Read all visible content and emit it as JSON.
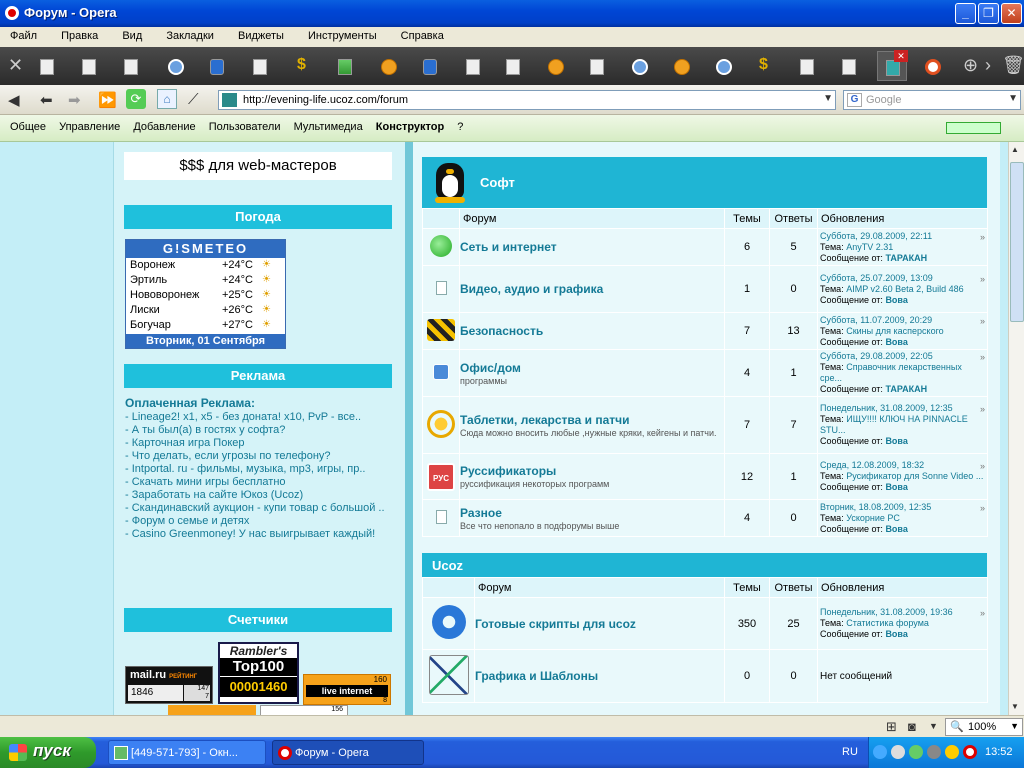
{
  "window": {
    "title": "Форум - Opera"
  },
  "menu": [
    "Файл",
    "Правка",
    "Вид",
    "Закладки",
    "Виджеты",
    "Инструменты",
    "Справка"
  ],
  "address": {
    "url": "http://evening-life.ucoz.com/forum",
    "search_placeholder": "Google",
    "search_engine_icon": "G"
  },
  "ucoz_panel": {
    "items": [
      "Общее",
      "Управление",
      "Добавление",
      "Пользователи",
      "Мультимедиа"
    ],
    "bold_item": "Конструктор",
    "help": "?"
  },
  "left": {
    "webmasters": "$$$ для web-мастеров",
    "weather_title": "Погода",
    "gismeteo": {
      "title": "G!SMETEO",
      "rows": [
        {
          "city": "Воронеж",
          "temp": "+24°C"
        },
        {
          "city": "Эртиль",
          "temp": "+24°C"
        },
        {
          "city": "Нововоронеж",
          "temp": "+25°C"
        },
        {
          "city": "Лиски",
          "temp": "+26°C"
        },
        {
          "city": "Богучар",
          "temp": "+27°C"
        }
      ],
      "date": "Вторник, 01 Сентября"
    },
    "ads_title": "Реклама",
    "ads_paid": "Оплаченная Реклама:",
    "ads": [
      "- Lineage2! x1, x5 - без доната! x10, PvP - все..",
      "- А ты был(а) в гостях у софта?",
      "- Карточная игра Покер",
      "- Что делать, если угрозы по телефону?",
      "- Intportal. ru - фильмы, музыка, mp3, игры, пр..",
      "- Скачать мини игры бесплатно",
      "- Заработать на сайте Юкоз (Ucoz)",
      "- Скандинавский аукцион - купи товар с большой ..",
      "- Форум о семье и детях",
      "- Casino Greenmoney! У нас выигрывает каждый!"
    ],
    "counters_title": "Счетчики",
    "counters": {
      "mail_logo": "mail.ru",
      "mail_tag": "РЕЙТИНГ",
      "mail_value": "1846",
      "mail_small1": "147",
      "mail_small2": "7",
      "rambler_name": "Rambler's",
      "rambler_top": "Top100",
      "rambler_value": "00001460",
      "li_value1": "160",
      "li_logo": "live internet",
      "li_value2": "8",
      "extra_value": "156"
    }
  },
  "forum": {
    "categories": [
      {
        "title": "Софт",
        "headers": {
          "forum": "Форум",
          "topics": "Темы",
          "replies": "Ответы",
          "updates": "Обновления"
        },
        "rows": [
          {
            "icon": "network-icon",
            "name": "Сеть и интернет",
            "desc": "",
            "topics": "6",
            "replies": "5",
            "date": "Суббота, 29.08.2009, 22:11",
            "topic_label": "Тема:",
            "topic": "AnyTV 2.31",
            "msg_label": "Сообщение от:",
            "author": "ТАРАКАН"
          },
          {
            "icon": "document-icon",
            "name": "Видео, аудио и графика",
            "desc": "",
            "topics": "1",
            "replies": "0",
            "date": "Суббота, 25.07.2009, 13:09",
            "topic_label": "Тема:",
            "topic": "AIMP v2.60 Beta 2, Build 486",
            "msg_label": "Сообщение от:",
            "author": "Вова"
          },
          {
            "icon": "security-icon",
            "name": "Безопасность",
            "desc": "",
            "topics": "7",
            "replies": "13",
            "date": "Суббота, 11.07.2009, 20:29",
            "topic_label": "Тема:",
            "topic": "Скины для касперского",
            "msg_label": "Сообщение от:",
            "author": "Вова"
          },
          {
            "icon": "office-icon",
            "name": "Офис/дом",
            "desc": "программы",
            "topics": "4",
            "replies": "1",
            "date": "Суббота, 29.08.2009, 22:05",
            "topic_label": "Тема:",
            "topic": "Справочник лекарственных сре...",
            "msg_label": "Сообщение от:",
            "author": "ТАРАКАН"
          },
          {
            "icon": "keys-icon",
            "name": "Таблетки, лекарства и патчи",
            "desc": "Сюда можно вносить любые ,нужные кряки, кейгены и патчи.",
            "topics": "7",
            "replies": "7",
            "date": "Понедельник, 31.08.2009, 12:35",
            "topic_label": "Тема:",
            "topic": "ИЩУ!!!! КЛЮЧ НА PINNACLE STU...",
            "msg_label": "Сообщение от:",
            "author": "Вова"
          },
          {
            "icon": "russifier-icon",
            "name": "Руссификаторы",
            "desc": "руссификация некоторых программ",
            "topics": "12",
            "replies": "1",
            "date": "Среда, 12.08.2009, 18:32",
            "topic_label": "Тема:",
            "topic": "Русификатор для Sonne Video ...",
            "msg_label": "Сообщение от:",
            "author": "Вова"
          },
          {
            "icon": "document-icon",
            "name": "Разное",
            "desc": "Все что непопало в подфорумы выше",
            "topics": "4",
            "replies": "0",
            "date": "Вторник, 18.08.2009, 12:35",
            "topic_label": "Тема:",
            "topic": "Ускорние PC",
            "msg_label": "Сообщение от:",
            "author": "Вова"
          }
        ]
      },
      {
        "title": "Ucoz",
        "headers": {
          "forum": "Форум",
          "topics": "Темы",
          "replies": "Ответы",
          "updates": "Обновления"
        },
        "rows": [
          {
            "icon": "gears-icon",
            "name": "Готовые скрипты для ucoz",
            "topics": "350",
            "replies": "25",
            "date": "Понедельник, 31.08.2009, 19:36",
            "topic_label": "Тема:",
            "topic": "Статистика форума",
            "msg_label": "Сообщение от:",
            "author": "Вова"
          },
          {
            "icon": "drawing-icon",
            "name": "Графика и Шаблоны",
            "topics": "0",
            "replies": "0",
            "no_messages": "Нет сообщений"
          }
        ]
      }
    ]
  },
  "status": {
    "zoom": "100%"
  },
  "taskbar": {
    "start": "пуск",
    "task1": "[449-571-793] - Окн...",
    "task2": "Форум - Opera",
    "lang": "RU",
    "clock": "13:52"
  }
}
